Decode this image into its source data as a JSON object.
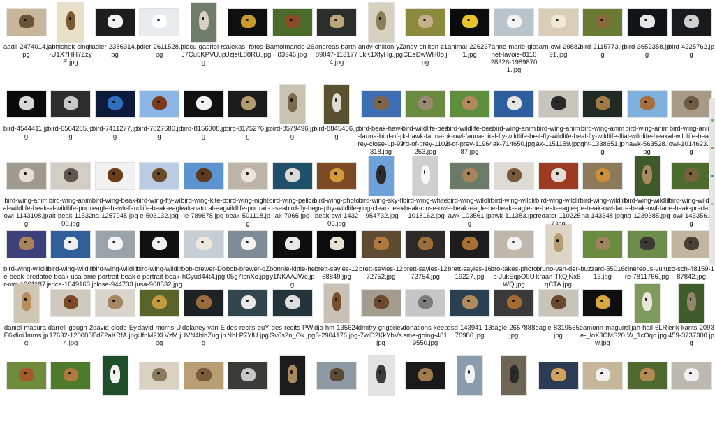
{
  "files": [
    {
      "name": "aadil-2474014.jpg",
      "bg": "#c9b79b",
      "fg": "#6b5336",
      "shape": "land"
    },
    {
      "name": "abhishek-singh-U1X7HH7ZzyE.jpg",
      "bg": "#e9e0c9",
      "fg": "#7b5a2f",
      "shape": "port"
    },
    {
      "name": "adler-2386314.jpg",
      "bg": "#1d1d1d",
      "fg": "#f2f2f2",
      "shape": "land"
    },
    {
      "name": "adler-2611528.jpg",
      "bg": "#e8ecef",
      "fg": "#ffffff",
      "shape": "land"
    },
    {
      "name": "alecu-gabriel-rsJ7Cu5KPVU.jpg",
      "bg": "#6f7e6a",
      "fg": "#d9cfbf",
      "shape": "port"
    },
    {
      "name": "alexas_fotos-BUzjetL88RU.jpg",
      "bg": "#0f0f10",
      "fg": "#c79a2b",
      "shape": "land"
    },
    {
      "name": "amolmande-2683946.jpg",
      "bg": "#4b6b2c",
      "fg": "#8a4a25",
      "shape": "land"
    },
    {
      "name": "andreas-barth-89047-1131774.jpg",
      "bg": "#2a2f2c",
      "fg": "#bba57a",
      "shape": "land"
    },
    {
      "name": "andy-chilton-yZLkK1XfyHg.jpg",
      "bg": "#d7d2bf",
      "fg": "#8a7d5c",
      "shape": "port"
    },
    {
      "name": "andy-chilton-z1CEeDwWH0o.jpg",
      "bg": "#8b8a3f",
      "fg": "#c7b089",
      "shape": "land"
    },
    {
      "name": "animal-2262371.jpg",
      "bg": "#0c0c0c",
      "fg": "#e8c22a",
      "shape": "land"
    },
    {
      "name": "anne-marie-gionet-lavoie-811028326-19898701.jpg",
      "bg": "#b9c4cc",
      "fg": "#f3f3f3",
      "shape": "land"
    },
    {
      "name": "barn-owl-2988291.jpg",
      "bg": "#d9cdb7",
      "fg": "#f2e9d6",
      "shape": "land"
    },
    {
      "name": "bird-2115773.jpg",
      "bg": "#6a7c34",
      "fg": "#8b6a3a",
      "shape": "land"
    },
    {
      "name": "bird-3652358.jpg",
      "bg": "#121417",
      "fg": "#e7e7e7",
      "shape": "land"
    },
    {
      "name": "bird-4225762.jpg",
      "bg": "#181a1d",
      "fg": "#cfcfcf",
      "shape": "land"
    },
    {
      "name": "bird-4544411.jpg",
      "bg": "#0a0a0a",
      "fg": "#d8d8d8",
      "shape": "land"
    },
    {
      "name": "bird-6564285.jpg",
      "bg": "#2d2d2d",
      "fg": "#c9c9c9",
      "shape": "land"
    },
    {
      "name": "bird-7411277.jpg",
      "bg": "#0d1a3a",
      "fg": "#2f6fc0",
      "shape": "land"
    },
    {
      "name": "bird-7827680.jpg",
      "bg": "#8bb6e6",
      "fg": "#7a3b1e",
      "shape": "land"
    },
    {
      "name": "bird-8156308.jpg",
      "bg": "#111111",
      "fg": "#f2f2f2",
      "shape": "land"
    },
    {
      "name": "bird-8175276.jpg",
      "bg": "#1b1b1b",
      "fg": "#b49b6d",
      "shape": "land"
    },
    {
      "name": "bird-8579496.jpg",
      "bg": "#c9c3b3",
      "fg": "#7d6a4d",
      "shape": "port"
    },
    {
      "name": "bird-8845466.jpg",
      "bg": "#59512f",
      "fg": "#dedbd0",
      "shape": "port"
    },
    {
      "name": "bird-beak-hawk-fauna-bird-of-prey-close-up-99318.jpg",
      "bg": "#3d6eb3",
      "fg": "#7f6548",
      "shape": "land"
    },
    {
      "name": "bird-wildlife-beak-hawk-fauna-bird-of-prey-1102253.jpg",
      "bg": "#6a8b3f",
      "fg": "#9b8a73",
      "shape": "land"
    },
    {
      "name": "bird-wildlife-beak-owl-fauna-bird-of-prey-1196487.jpg",
      "bg": "#5f8e3e",
      "fg": "#b0895c",
      "shape": "land"
    },
    {
      "name": "bird-wing-animal-fly-wildlife-beak-714650.jpg",
      "bg": "#2d5fa0",
      "fg": "#e5e5e5",
      "shape": "land"
    },
    {
      "name": "bird-wing-animal-fly-wildlife-beak-1151159.jpg",
      "bg": "#c8c5bd",
      "fg": "#2a2a2a",
      "shape": "land"
    },
    {
      "name": "bird-wing-animal-fly-wildlife-flight-1338651.jpg",
      "bg": "#1f2b25",
      "fg": "#a27a48",
      "shape": "land"
    },
    {
      "name": "bird-wing-animal-wildlife-beak-hawk-563528.jpg",
      "bg": "#7fb1e0",
      "fg": "#a8703e",
      "shape": "land"
    },
    {
      "name": "bird-wing-animal-wildlife-beak-owl-1014623.jpg",
      "bg": "#a79a86",
      "fg": "#6f5a42",
      "shape": "land"
    },
    {
      "name": "bird-wing-animal-wildlife-beak-owl-1143108.jpg",
      "bg": "#9f9b90",
      "fg": "#e5e1d6",
      "shape": "land"
    },
    {
      "name": "bird-wing-animal-wildlife-portrait-beak-1153208.jpg",
      "bg": "#d2cec6",
      "fg": "#5f5850",
      "shape": "land"
    },
    {
      "name": "bird-wing-beak-eagle-hawk-fauna-1257945.jpg",
      "bg": "#f1f1f1",
      "fg": "#6d3d18",
      "shape": "land"
    },
    {
      "name": "bird-wing-fly-wildlife-beak-eagle-503132.jpg",
      "bg": "#b9cde2",
      "fg": "#6b4a2b",
      "shape": "land"
    },
    {
      "name": "bird-wing-kite-beak-natural-eagle-789678.jpg",
      "bg": "#5b94d1",
      "fg": "#5d3b22",
      "shape": "land"
    },
    {
      "name": "bird-wing-night-wildlife-portrait-beak-501118.jpg",
      "bg": "#bdb6a8",
      "fg": "#ece7de",
      "shape": "land"
    },
    {
      "name": "bird-wing-pelican-seabird-fly-beak-7065.jpg",
      "bg": "#1e4f6b",
      "fg": "#dadada",
      "shape": "land"
    },
    {
      "name": "bird-wing-photography-wildlife-beak-owl-143206.jpg",
      "bg": "#7c4b26",
      "fg": "#d79a39",
      "shape": "land"
    },
    {
      "name": "bird-wing-sky-flying-clear-beak-954732.jpg",
      "bg": "#6ea2dc",
      "fg": "#2b2b2b",
      "shape": "port"
    },
    {
      "name": "bird-wing-white-beak-close-owl-1018162.jpg",
      "bg": "#cfcfcf",
      "fg": "#f7f7f7",
      "shape": "port"
    },
    {
      "name": "bird-wing-wildlife-beak-eagle-hawk-103561.jpg",
      "bg": "#6b7b6a",
      "fg": "#a68358",
      "shape": "land"
    },
    {
      "name": "bird-wing-wildlife-beak-eagle-hawk-111383.jpg",
      "bg": "#dedad4",
      "fg": "#7a5a3e",
      "shape": "land"
    },
    {
      "name": "bird-wing-wildlife-beak-eagle-predator-1102257.jpg",
      "bg": "#9c3b1f",
      "fg": "#e3dfd8",
      "shape": "land"
    },
    {
      "name": "bird-wing-wildlife-beak-owl-fauna-143348.jpg",
      "bg": "#8e7a5b",
      "fg": "#cf8f3a",
      "shape": "land"
    },
    {
      "name": "bird-wing-wildlife-beak-owl-fauna-1239385.jpg",
      "bg": "#3e5a2a",
      "fg": "#a98a5c",
      "shape": "port"
    },
    {
      "name": "bird-wing-wildlife-beak-predator-owl-143356.jpg",
      "bg": "#4c6b2f",
      "fg": "#7b6341",
      "shape": "land"
    },
    {
      "name": "bird-wing-wildlife-beak-predator-owl-1261187.jpg",
      "bg": "#3b3f7a",
      "fg": "#a9825a",
      "shape": "land"
    },
    {
      "name": "bird-wing-wildlife-beak-usa-america-1049163.jpg",
      "bg": "#305f9c",
      "fg": "#f0f0f0",
      "shape": "land"
    },
    {
      "name": "bird-wing-wildlife-portrait-beak-close-944733.jpg",
      "bg": "#9aa3a8",
      "fg": "#f5f5f5",
      "shape": "land"
    },
    {
      "name": "bird-wing-wildlife-portrait-beak-usa-968532.jpg",
      "bg": "#121212",
      "fg": "#f1f1f1",
      "shape": "land"
    },
    {
      "name": "bob-brewer-DohCyud44t4.jpg",
      "bg": "#c7cfd6",
      "fg": "#efe8dc",
      "shape": "land"
    },
    {
      "name": "bob-brewer-qZ05g7IsnXo.jpg",
      "bg": "#7f8c96",
      "fg": "#f3f3f3",
      "shape": "land"
    },
    {
      "name": "bonnie-kittle-hey1NKAAJWc.jpg",
      "bg": "#0e0e0e",
      "fg": "#e8e8e8",
      "shape": "land"
    },
    {
      "name": "brett-sayles-1268849.jpg",
      "bg": "#0b0b0b",
      "fg": "#e9e1d2",
      "shape": "land"
    },
    {
      "name": "brett-sayles-1272752.jpg",
      "bg": "#5f4a32",
      "fg": "#b17a3c",
      "shape": "land"
    },
    {
      "name": "brett-sayles-1272754.jpg",
      "bg": "#2b2a26",
      "fg": "#9c6d3b",
      "shape": "land"
    },
    {
      "name": "brett-sayles-1619227.jpg",
      "bg": "#1d1d1d",
      "fg": "#a66f34",
      "shape": "land"
    },
    {
      "name": "bro-takes-photos-JukEqpO9UWQ.jpg",
      "bg": "#c0b8ab",
      "fg": "#f2f2f2",
      "shape": "land"
    },
    {
      "name": "bruno-van-der-kraan-TkQjNx6qCTA.jpg",
      "bg": "#ddd6c6",
      "fg": "#b79d74",
      "shape": "port"
    },
    {
      "name": "buzzard-5501613.jpg",
      "bg": "#6b8c3e",
      "fg": "#a0835f",
      "shape": "land"
    },
    {
      "name": "cinereous-vulture-7811766.jpg",
      "bg": "#6d8d4a",
      "fg": "#3c3a36",
      "shape": "land"
    },
    {
      "name": "co-sch-48159-187842.jpg",
      "bg": "#c2b6a2",
      "fg": "#4a4036",
      "shape": "land"
    },
    {
      "name": "daniel-macura-E6xfioiJmms.jpg",
      "bg": "#d0c6b6",
      "fg": "#b68d5b",
      "shape": "port"
    },
    {
      "name": "darrell-gough-217632-1200854.jpg",
      "bg": "#cfc9c0",
      "fg": "#7c4a25",
      "shape": "land"
    },
    {
      "name": "david-clode-EyEdZ2aKRfA.jpg",
      "bg": "#d9d4cc",
      "fg": "#a78761",
      "shape": "land"
    },
    {
      "name": "david-morris-UUfnM2XLVzM.jpg",
      "bg": "#59642a",
      "fg": "#c49a3e",
      "shape": "land"
    },
    {
      "name": "delaney-van-EUVN4bihZug.jpg",
      "bg": "#1d2227",
      "fg": "#9a6c3d",
      "shape": "land"
    },
    {
      "name": "des-recits-euYNhLP7YlU.jpg",
      "bg": "#32464f",
      "fg": "#e9e9e9",
      "shape": "land"
    },
    {
      "name": "des-recits-PWGv6s2n_Ok.jpg",
      "bg": "#24343b",
      "fg": "#dedede",
      "shape": "land"
    },
    {
      "name": "djo-hm-1356243-2904176.jpg",
      "bg": "#c8c2b6",
      "fg": "#7a4f2c",
      "shape": "port"
    },
    {
      "name": "dmitry-grigoriev-7wlD2KkYbVs.jpg",
      "bg": "#a49d8f",
      "fg": "#6b4a2e",
      "shape": "land"
    },
    {
      "name": "donations-keepsme-going-4819550.jpg",
      "bg": "#c6c6c6",
      "fg": "#7c7c7c",
      "shape": "land"
    },
    {
      "name": "dsd-143941-1376986.jpg",
      "bg": "#2a4050",
      "fg": "#b08a5f",
      "shape": "land"
    },
    {
      "name": "eagle-2657888.jpg",
      "bg": "#3a3a3a",
      "fg": "#a46b34",
      "shape": "land"
    },
    {
      "name": "eagle-8319555.jpg",
      "bg": "#c9c4ba",
      "fg": "#6a4a2e",
      "shape": "land"
    },
    {
      "name": "eamonn-maguire-_loXJCMS20w.jpg",
      "bg": "#0f0f0f",
      "fg": "#d9a73c",
      "shape": "land"
    },
    {
      "name": "elijah-hail-6LRIW_1cOqc.jpg",
      "bg": "#7e9a5c",
      "fg": "#ece6d8",
      "shape": "port"
    },
    {
      "name": "erik-karits-2093459-3737300.jpg",
      "bg": "#3f5b2b",
      "fg": "#94846a",
      "shape": "port"
    },
    {
      "name": "",
      "bg": "#6e8c3c",
      "fg": "#a65a2a",
      "shape": "land"
    },
    {
      "name": "",
      "bg": "#4e7a2c",
      "fg": "#b07a3f",
      "shape": "land"
    },
    {
      "name": "",
      "bg": "#1e4f2a",
      "fg": "#f2f2f2",
      "shape": "port"
    },
    {
      "name": "",
      "bg": "#d9d2c3",
      "fg": "#8c7a5e",
      "shape": "land"
    },
    {
      "name": "",
      "bg": "#b99d74",
      "fg": "#7a5a3a",
      "shape": "land"
    },
    {
      "name": "",
      "bg": "#3a3c3a",
      "fg": "#c7c7c7",
      "shape": "land"
    },
    {
      "name": "",
      "bg": "#1c1c1c",
      "fg": "#a88a62",
      "shape": "port"
    },
    {
      "name": "",
      "bg": "#8d9aa3",
      "fg": "#5d4a36",
      "shape": "land"
    },
    {
      "name": "",
      "bg": "#e3e3e3",
      "fg": "#3a3a3a",
      "shape": "port"
    },
    {
      "name": "",
      "bg": "#1a1a1a",
      "fg": "#a07a4c",
      "shape": "land"
    },
    {
      "name": "",
      "bg": "#8b9dad",
      "fg": "#f3f3f3",
      "shape": "port"
    },
    {
      "name": "",
      "bg": "#6e6654",
      "fg": "#2b2b2b",
      "shape": "port"
    },
    {
      "name": "",
      "bg": "#2c3c55",
      "fg": "#d3a25a",
      "shape": "land"
    },
    {
      "name": "",
      "bg": "#c7b79a",
      "fg": "#f1f1f1",
      "shape": "land"
    },
    {
      "name": "",
      "bg": "#4f6a2e",
      "fg": "#b38b52",
      "shape": "land"
    },
    {
      "name": "",
      "bg": "#bdb9b1",
      "fg": "#f1f1f1",
      "shape": "land"
    }
  ],
  "side_handle": {
    "dot_colors": [
      "#7aa85a",
      "#d08b2a",
      "#4a7ac0",
      "#c0c0c0"
    ]
  }
}
